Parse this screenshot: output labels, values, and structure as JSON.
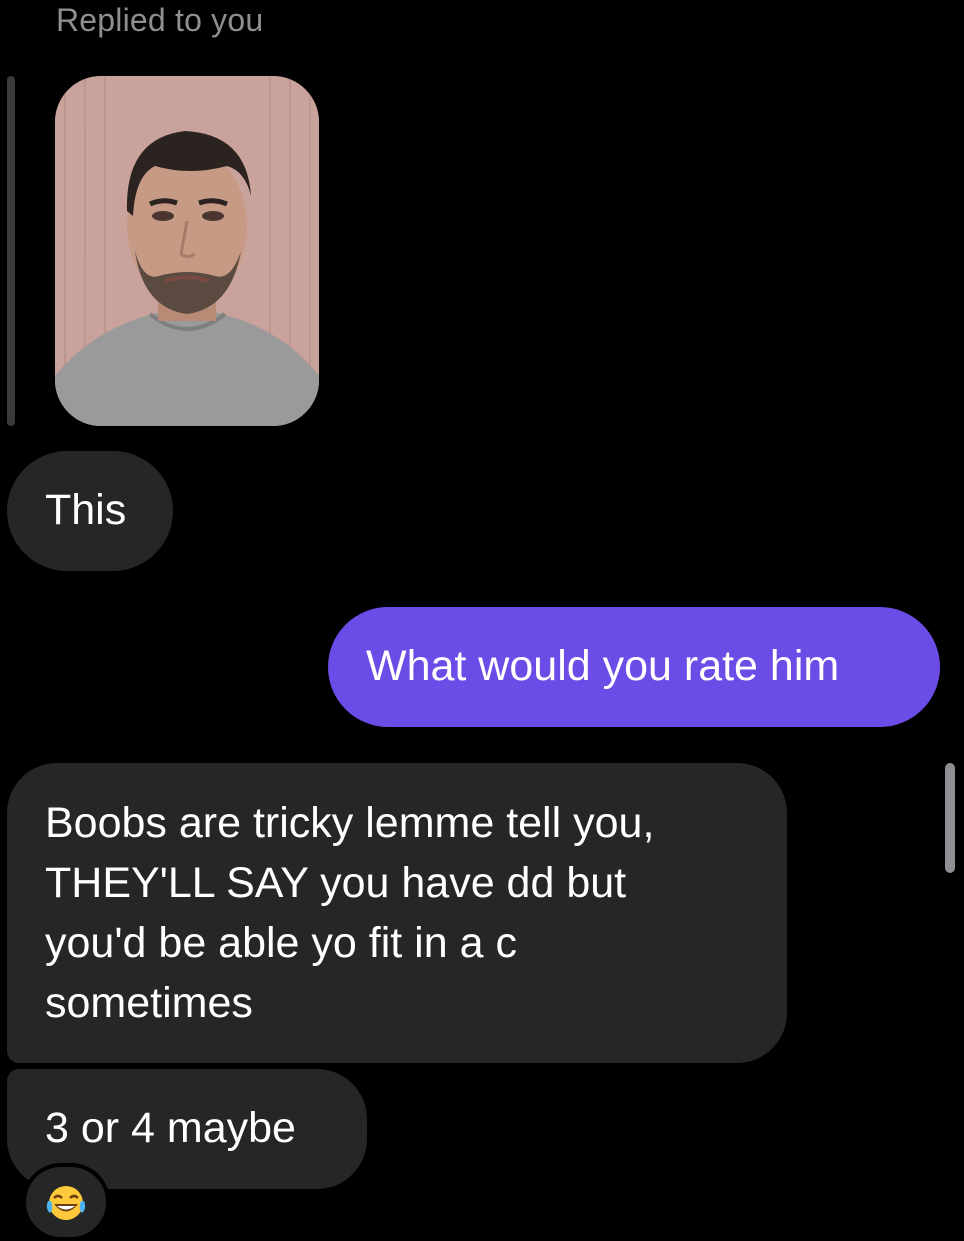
{
  "thread": {
    "reply_label": "Replied to you",
    "messages": [
      {
        "sender": "them",
        "text": "This"
      },
      {
        "sender": "me",
        "text": "What would you rate him"
      },
      {
        "sender": "them",
        "text": "Boobs are tricky lemme tell you,\nTHEY'LL SAY you have dd but\nyou'd be able yo fit in a c\nsometimes"
      },
      {
        "sender": "them",
        "text": "3 or 4 maybe"
      }
    ],
    "reaction": {
      "icon": "laughing-crying-emoji-icon"
    }
  },
  "colors": {
    "background": "#000000",
    "incoming_bubble": "#262626",
    "outgoing_bubble": "#6b4ce6",
    "muted_text": "#8e8e93"
  }
}
